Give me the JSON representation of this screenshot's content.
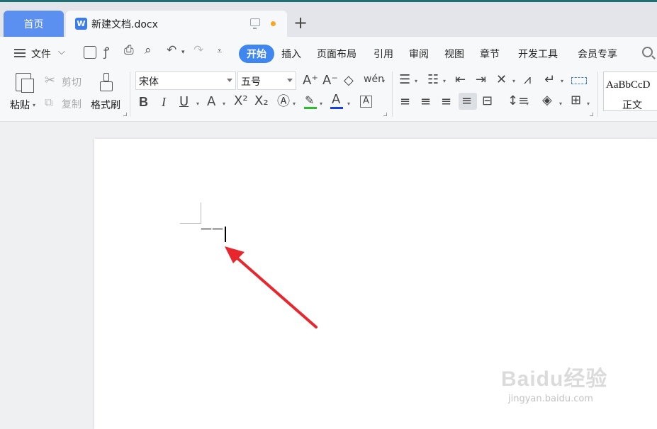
{
  "tabs": {
    "home": "首页",
    "document": "新建文档.docx",
    "doc_icon_letter": "W",
    "add_label": "+"
  },
  "menu": {
    "file": "文件",
    "items": [
      "开始",
      "插入",
      "页面布局",
      "引用",
      "审阅",
      "视图",
      "章节",
      "开发工具",
      "会员专享"
    ]
  },
  "ribbon": {
    "paste": "粘贴",
    "cut": "剪切",
    "copy": "复制",
    "format_painter": "格式刷",
    "font_name": "宋体",
    "font_size": "五号",
    "style_sample": "AaBbCcD",
    "style_name": "正文"
  },
  "document": {
    "typed_text": "——"
  },
  "watermark": {
    "logo": "Baidu经验",
    "url": "jingyan.baidu.com"
  },
  "colors": {
    "accent": "#3f86f0",
    "home_tab": "#5b8ff0",
    "arrow": "#e8262e",
    "highlight": "#2dbd2d",
    "font_color": "#1a3ee0"
  }
}
